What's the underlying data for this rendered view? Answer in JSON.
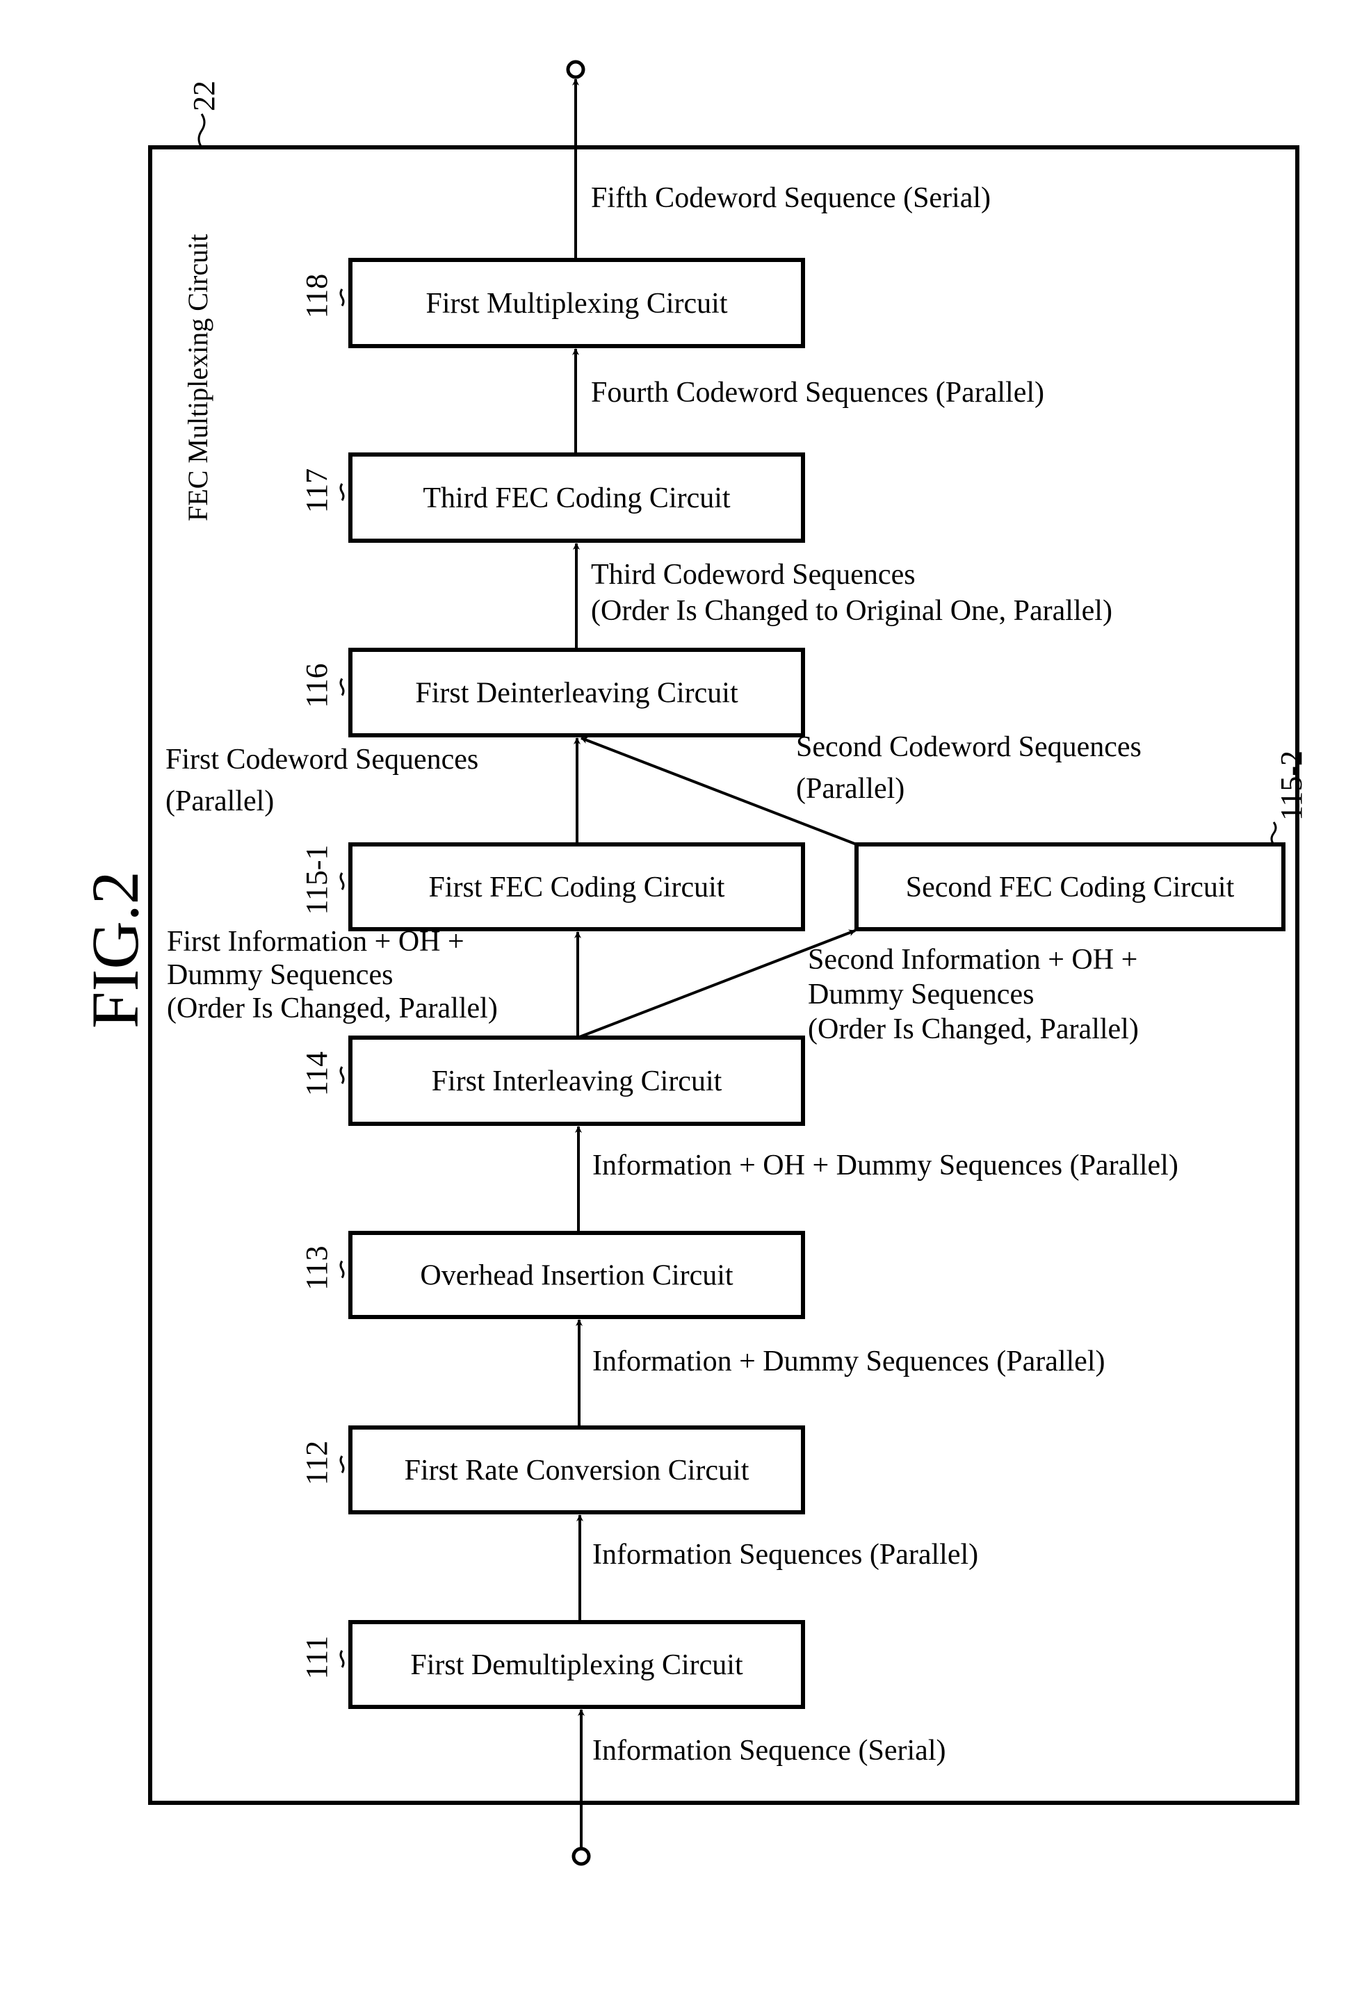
{
  "figure": {
    "title": "FIG.2",
    "frame_label": "FEC Multiplexing Circuit",
    "frame_ref": "22"
  },
  "blocks": [
    {
      "id": "118",
      "ref": "118",
      "label": "First Multiplexing Circuit"
    },
    {
      "id": "117",
      "ref": "117",
      "label": "Third FEC Coding Circuit"
    },
    {
      "id": "116",
      "ref": "116",
      "label": "First Deinterleaving Circuit"
    },
    {
      "id": "115-1",
      "ref": "115-1",
      "label": "First FEC Coding Circuit"
    },
    {
      "id": "115-2",
      "ref": "115-2",
      "label": "Second FEC Coding Circuit"
    },
    {
      "id": "114",
      "ref": "114",
      "label": "First Interleaving Circuit"
    },
    {
      "id": "113",
      "ref": "113",
      "label": "Overhead Insertion Circuit"
    },
    {
      "id": "112",
      "ref": "112",
      "label": "First Rate Conversion Circuit"
    },
    {
      "id": "111",
      "ref": "111",
      "label": "First Demultiplexing Circuit"
    }
  ],
  "signals": {
    "output": [
      "Fifth Codeword Sequence (Serial)"
    ],
    "s118_in": [
      "Fourth Codeword Sequences (Parallel)"
    ],
    "s117_in": [
      "Third Codeword Sequences",
      "(Order Is Changed to Original One, Parallel)"
    ],
    "s115_1_out": [
      "First Codeword Sequences",
      "(Parallel)"
    ],
    "s115_2_out": [
      "Second Codeword Sequences",
      "(Parallel)"
    ],
    "s114_out_1": [
      "First Information + OH +",
      "Dummy Sequences",
      "(Order Is Changed, Parallel)"
    ],
    "s114_out_2": [
      "Second Information + OH +",
      "Dummy Sequences",
      "(Order Is Changed, Parallel)"
    ],
    "s114_in": [
      "Information + OH + Dummy Sequences (Parallel)"
    ],
    "s113_in": [
      "Information + Dummy Sequences (Parallel)"
    ],
    "s112_in": [
      "Information Sequences (Parallel)"
    ],
    "input": [
      "Information Sequence (Serial)"
    ]
  },
  "connections": [
    {
      "from": "input",
      "to": "111"
    },
    {
      "from": "111",
      "to": "112"
    },
    {
      "from": "112",
      "to": "113"
    },
    {
      "from": "113",
      "to": "114"
    },
    {
      "from": "114",
      "to": "115-1"
    },
    {
      "from": "114",
      "to": "115-2"
    },
    {
      "from": "115-1",
      "to": "116"
    },
    {
      "from": "115-2",
      "to": "116"
    },
    {
      "from": "116",
      "to": "117"
    },
    {
      "from": "117",
      "to": "118"
    },
    {
      "from": "118",
      "to": "output"
    }
  ]
}
